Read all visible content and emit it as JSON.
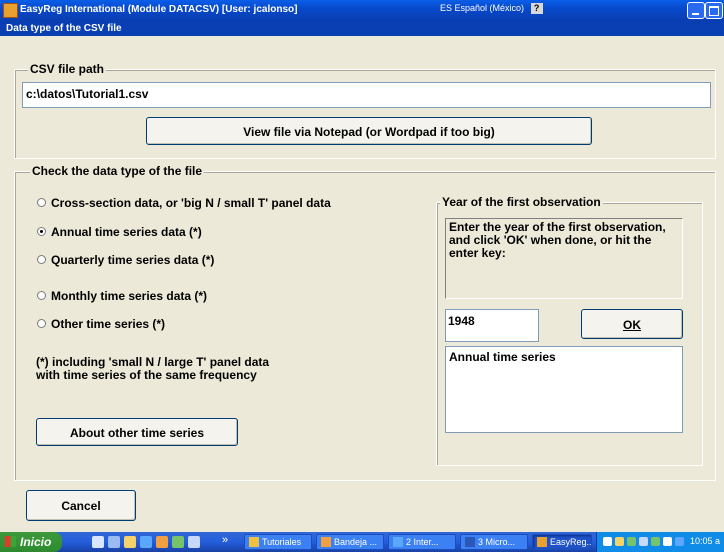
{
  "window": {
    "title": "EasyReg International (Module DATACSV) [User: jcalonso]",
    "language": "ES Español (México)",
    "help_glyph": "?"
  },
  "dialog": {
    "title": "Data type of the CSV file"
  },
  "csv": {
    "legend": "CSV file path",
    "path": "c:\\datos\\Tutorial1.csv",
    "view_button": "View file via Notepad (or Wordpad if too big)"
  },
  "datatype": {
    "legend": "Check the data type of the file",
    "options": [
      {
        "label": "Cross-section data, or 'big N / small T' panel data",
        "selected": false
      },
      {
        "label": "Annual time series data (*)",
        "selected": true
      },
      {
        "label": "Quarterly time series data (*)",
        "selected": false
      },
      {
        "label": "Monthly time series data (*)",
        "selected": false
      },
      {
        "label": "Other time series (*)",
        "selected": false
      }
    ],
    "footnote": "(*) including 'small N / large T' panel data with time series of the same frequency",
    "about_button": "About other time series"
  },
  "year": {
    "legend": "Year of the first observation",
    "instructions": "Enter the year of the first observation, and click 'OK' when done, or hit the enter key:",
    "value": "1948",
    "ok_button": "OK",
    "result": "Annual time series"
  },
  "cancel_button": "Cancel",
  "taskbar": {
    "start_label": "Inicio",
    "overflow": "»",
    "tasks": [
      "Tutoriales",
      "Bandeja ...",
      "2 Inter...",
      "3 Micro...",
      "EasyReg..."
    ],
    "clock": "10:05 a"
  }
}
